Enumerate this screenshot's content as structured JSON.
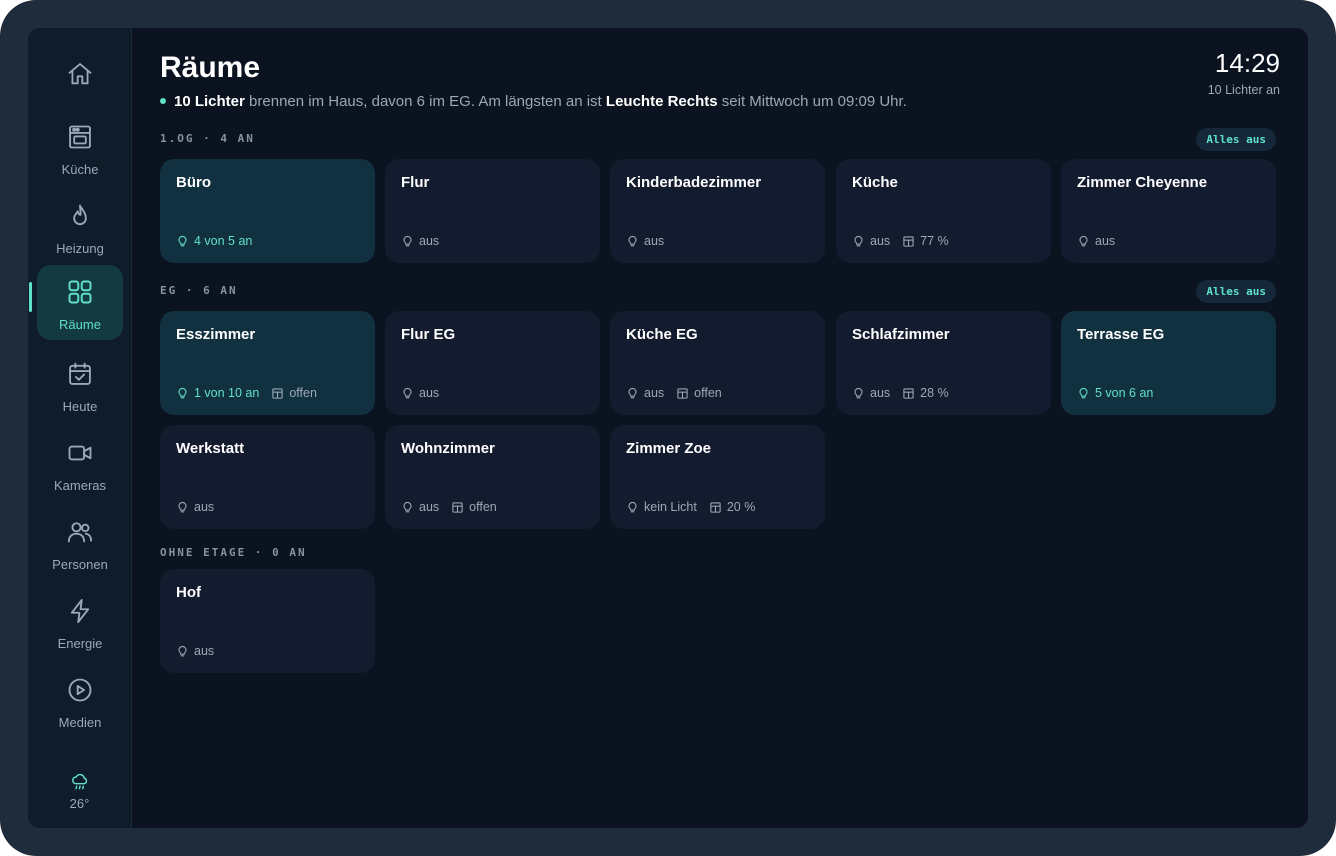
{
  "nav": {
    "items": [
      {
        "label": "",
        "icon": "home-icon"
      },
      {
        "label": "Küche",
        "icon": "oven-icon"
      },
      {
        "label": "Heizung",
        "icon": "flame-icon"
      },
      {
        "label": "Räume",
        "icon": "grid-icon",
        "active": true
      },
      {
        "label": "Heute",
        "icon": "calendar-check-icon"
      },
      {
        "label": "Kameras",
        "icon": "camera-icon"
      },
      {
        "label": "Personen",
        "icon": "people-icon"
      },
      {
        "label": "Energie",
        "icon": "bolt-icon"
      },
      {
        "label": "Medien",
        "icon": "play-icon"
      }
    ],
    "weather": {
      "icon": "rain-cloud-icon",
      "temp": "26°"
    }
  },
  "header": {
    "title": "Räume",
    "summary": {
      "count": "10 Lichter",
      "text1": " brennen im Haus, davon 6 im EG. Am längsten an ist ",
      "longest": "Leuchte Rechts",
      "text2": " seit Mittwoch um 09:09 Uhr."
    },
    "clock": "14:29",
    "lights_on": "10 Lichter an"
  },
  "sections": [
    {
      "label": "1.OG · 4 AN",
      "all_off": "Alles aus"
    },
    {
      "label": "EG · 6 AN",
      "all_off": "Alles aus"
    },
    {
      "label": "OHNE ETAGE · 0 AN"
    }
  ],
  "rooms": [
    {
      "name": "Büro",
      "light": "4 von 5 an",
      "on": true
    },
    {
      "name": "Flur",
      "light": "aus"
    },
    {
      "name": "Kinderbadezimmer",
      "light": "aus"
    },
    {
      "name": "Küche",
      "light": "aus",
      "blind": "77 %"
    },
    {
      "name": "Zimmer Cheyenne",
      "light": "aus"
    },
    {
      "name": "Esszimmer",
      "light": "1 von 10 an",
      "blind": "offen",
      "on": true
    },
    {
      "name": "Flur EG",
      "light": "aus"
    },
    {
      "name": "Küche EG",
      "light": "aus",
      "blind": "offen"
    },
    {
      "name": "Schlafzimmer",
      "light": "aus",
      "blind": "28 %"
    },
    {
      "name": "Terrasse EG",
      "light": "5 von 6 an",
      "on": true
    },
    {
      "name": "Werkstatt",
      "light": "aus"
    },
    {
      "name": "Wohnzimmer",
      "light": "aus",
      "blind": "offen"
    },
    {
      "name": "Zimmer Zoe",
      "light": "kein Licht",
      "blind": "20 %"
    },
    {
      "name": "Hof",
      "light": "aus"
    }
  ],
  "colors": {
    "accent": "#5fe0c8",
    "background": "#0b1220",
    "card": "#121c2e",
    "card_on": "#123140"
  }
}
